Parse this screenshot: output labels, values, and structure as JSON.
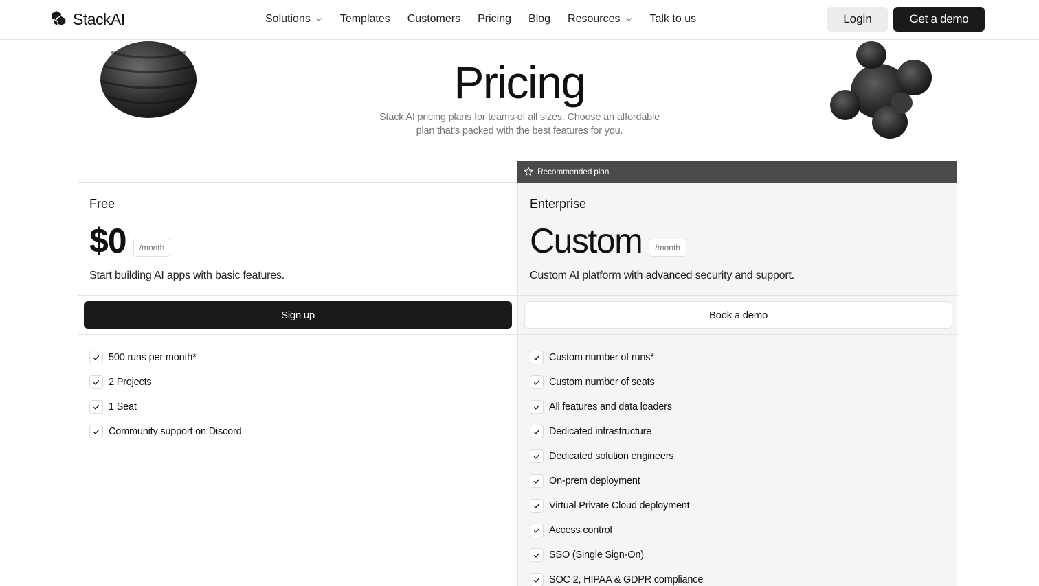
{
  "nav": {
    "logo_text": "StackAI",
    "links": [
      {
        "label": "Solutions",
        "has_dropdown": true
      },
      {
        "label": "Templates",
        "has_dropdown": false
      },
      {
        "label": "Customers",
        "has_dropdown": false
      },
      {
        "label": "Pricing",
        "has_dropdown": false
      },
      {
        "label": "Blog",
        "has_dropdown": false
      },
      {
        "label": "Resources",
        "has_dropdown": true
      },
      {
        "label": "Talk to us",
        "has_dropdown": false
      }
    ],
    "login_label": "Login",
    "demo_label": "Get a demo"
  },
  "hero": {
    "title": "Pricing",
    "subtitle": "Stack AI pricing plans for teams of all sizes. Choose an affordable plan that's packed with the best features for you."
  },
  "recommended": {
    "label": "Recommended plan",
    "icon": "star-icon"
  },
  "plans": {
    "free": {
      "name": "Free",
      "price": "$0",
      "period": "/month",
      "description": "Start building AI apps with basic features.",
      "cta": "Sign up",
      "features": [
        "500 runs per month*",
        "2 Projects",
        "1 Seat",
        "Community support on Discord"
      ]
    },
    "enterprise": {
      "name": "Enterprise",
      "price": "Custom",
      "period": "/month",
      "description": "Custom AI platform with advanced security and support.",
      "cta": "Book a demo",
      "features": [
        "Custom number of runs*",
        "Custom number of seats",
        "All features and data loaders",
        "Dedicated infrastructure",
        "Dedicated solution engineers",
        "On-prem deployment",
        "Virtual Private Cloud deployment",
        "Access control",
        "SSO (Single Sign-On)",
        "SOC 2, HIPAA & GDPR compliance"
      ]
    }
  },
  "colors": {
    "accent_dark": "#1a1a1a",
    "recommended_bar": "#4a4a4a",
    "enterprise_bg": "#f5f5f5"
  }
}
